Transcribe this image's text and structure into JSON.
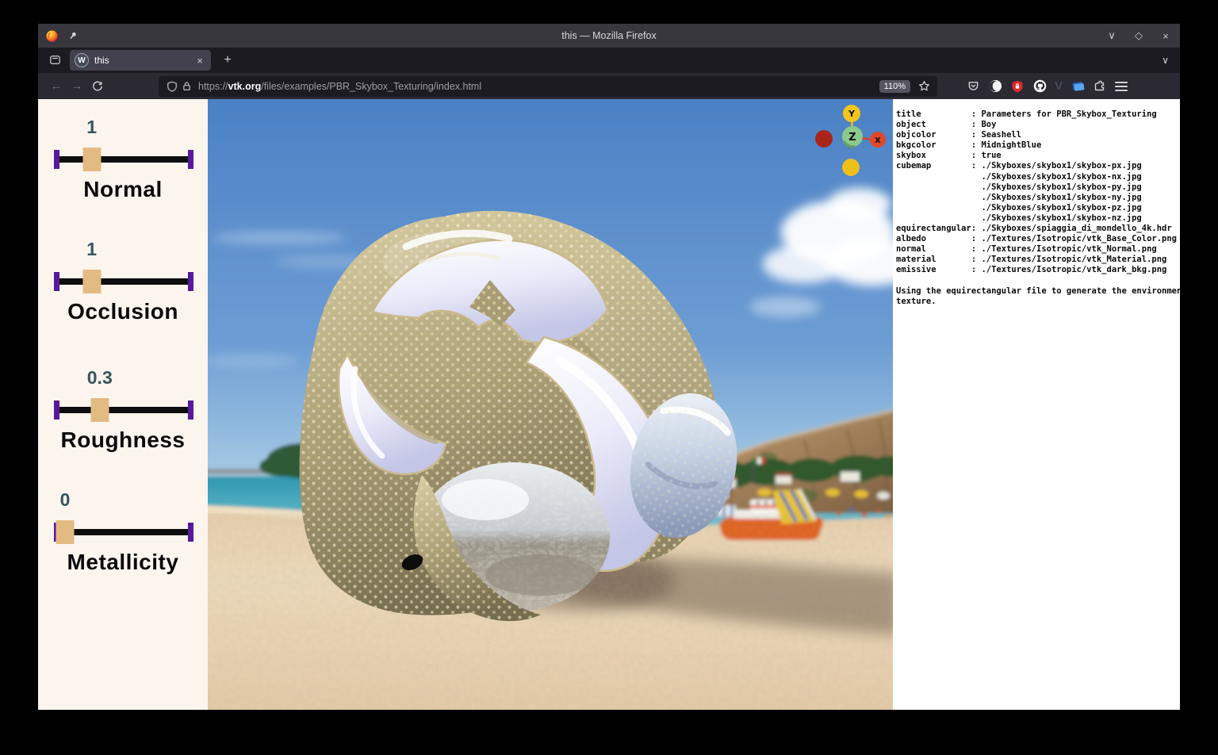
{
  "titlebar": {
    "title": "this — Mozilla Firefox",
    "minimize_glyph": "∨",
    "maximize_glyph": "◇",
    "close_glyph": "×"
  },
  "tabbar": {
    "tab_title": "this",
    "tab_favicon_letter": "W",
    "tab_close_glyph": "×",
    "new_tab_glyph": "+",
    "list_tabs_glyph": "∨"
  },
  "navbar": {
    "back_glyph": "←",
    "forward_glyph": "→",
    "url_scheme": "https://",
    "url_domain": "vtk.org",
    "url_path": "/files/examples/PBR_Skybox_Texturing/index.html",
    "zoom_badge": "110%"
  },
  "sidebar": {
    "sliders": [
      {
        "label": "Normal",
        "value": "1",
        "position_pct": 26
      },
      {
        "label": "Occlusion",
        "value": "1",
        "position_pct": 26
      },
      {
        "label": "Roughness",
        "value": "0.3",
        "position_pct": 32
      },
      {
        "label": "Metallicity",
        "value": "0",
        "position_pct": 6
      }
    ]
  },
  "scene": {
    "axes": {
      "x": "X",
      "y": "Y",
      "z": "Z"
    }
  },
  "info_panel": {
    "lines": [
      "title          : Parameters for PBR_Skybox_Texturing",
      "object         : Boy",
      "objcolor       : Seashell",
      "bkgcolor       : MidnightBlue",
      "skybox         : true",
      "cubemap        : ./Skyboxes/skybox1/skybox-px.jpg",
      "                 ./Skyboxes/skybox1/skybox-nx.jpg",
      "                 ./Skyboxes/skybox1/skybox-py.jpg",
      "                 ./Skyboxes/skybox1/skybox-ny.jpg",
      "                 ./Skyboxes/skybox1/skybox-pz.jpg",
      "                 ./Skyboxes/skybox1/skybox-nz.jpg",
      "equirectangular: ./Skyboxes/spiaggia_di_mondello_4k.hdr",
      "albedo         : ./Textures/Isotropic/vtk_Base_Color.png",
      "normal         : ./Textures/Isotropic/vtk_Normal.png",
      "material       : ./Textures/Isotropic/vtk_Material.png",
      "emissive       : ./Textures/Isotropic/vtk_dark_bkg.png",
      "",
      "Using the equirectangular file to generate the environment",
      "texture."
    ]
  },
  "colors": {
    "slider_cap": "#56199b",
    "slider_handle": "#e2bb83",
    "slider_value": "#36565e",
    "sidebar_bg": "#fbf5ee",
    "axis_x": "#e0482c",
    "axis_neg_x": "#a92419",
    "axis_y": "#f3c51d",
    "axis_z": "#8cc98c",
    "titlebar_bg": "#38373e",
    "tabstrip_bg": "#1c1b22",
    "navbar_bg": "#2b2a33"
  }
}
